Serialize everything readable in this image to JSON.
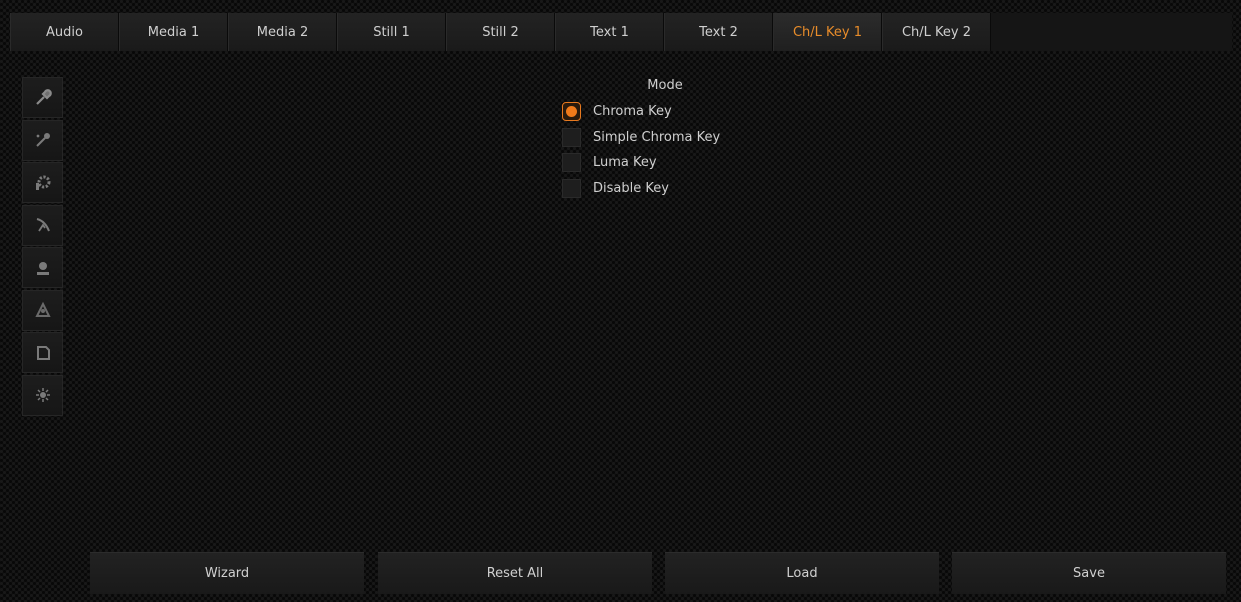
{
  "tabs": [
    {
      "label": "Audio"
    },
    {
      "label": "Media 1"
    },
    {
      "label": "Media 2"
    },
    {
      "label": "Still 1"
    },
    {
      "label": "Still 2"
    },
    {
      "label": "Text 1"
    },
    {
      "label": "Text 2"
    },
    {
      "label": "Ch/L Key 1",
      "active": true
    },
    {
      "label": "Ch/L Key 2"
    }
  ],
  "sidebar": {
    "icons": [
      "chroma-picker-icon",
      "color-picker-icon",
      "gear-icon",
      "spill-icon",
      "matte-icon",
      "crop-icon",
      "mask-icon",
      "effects-icon"
    ]
  },
  "mode": {
    "title": "Mode",
    "options": [
      {
        "label": "Chroma Key",
        "selected": true
      },
      {
        "label": "Simple Chroma Key",
        "selected": false
      },
      {
        "label": "Luma Key",
        "selected": false
      },
      {
        "label": "Disable Key",
        "selected": false
      }
    ]
  },
  "buttons": {
    "wizard": "Wizard",
    "reset_all": "Reset All",
    "load": "Load",
    "save": "Save"
  },
  "colors": {
    "accent": "#e8791f",
    "active_tab_text": "#e88c2a"
  }
}
